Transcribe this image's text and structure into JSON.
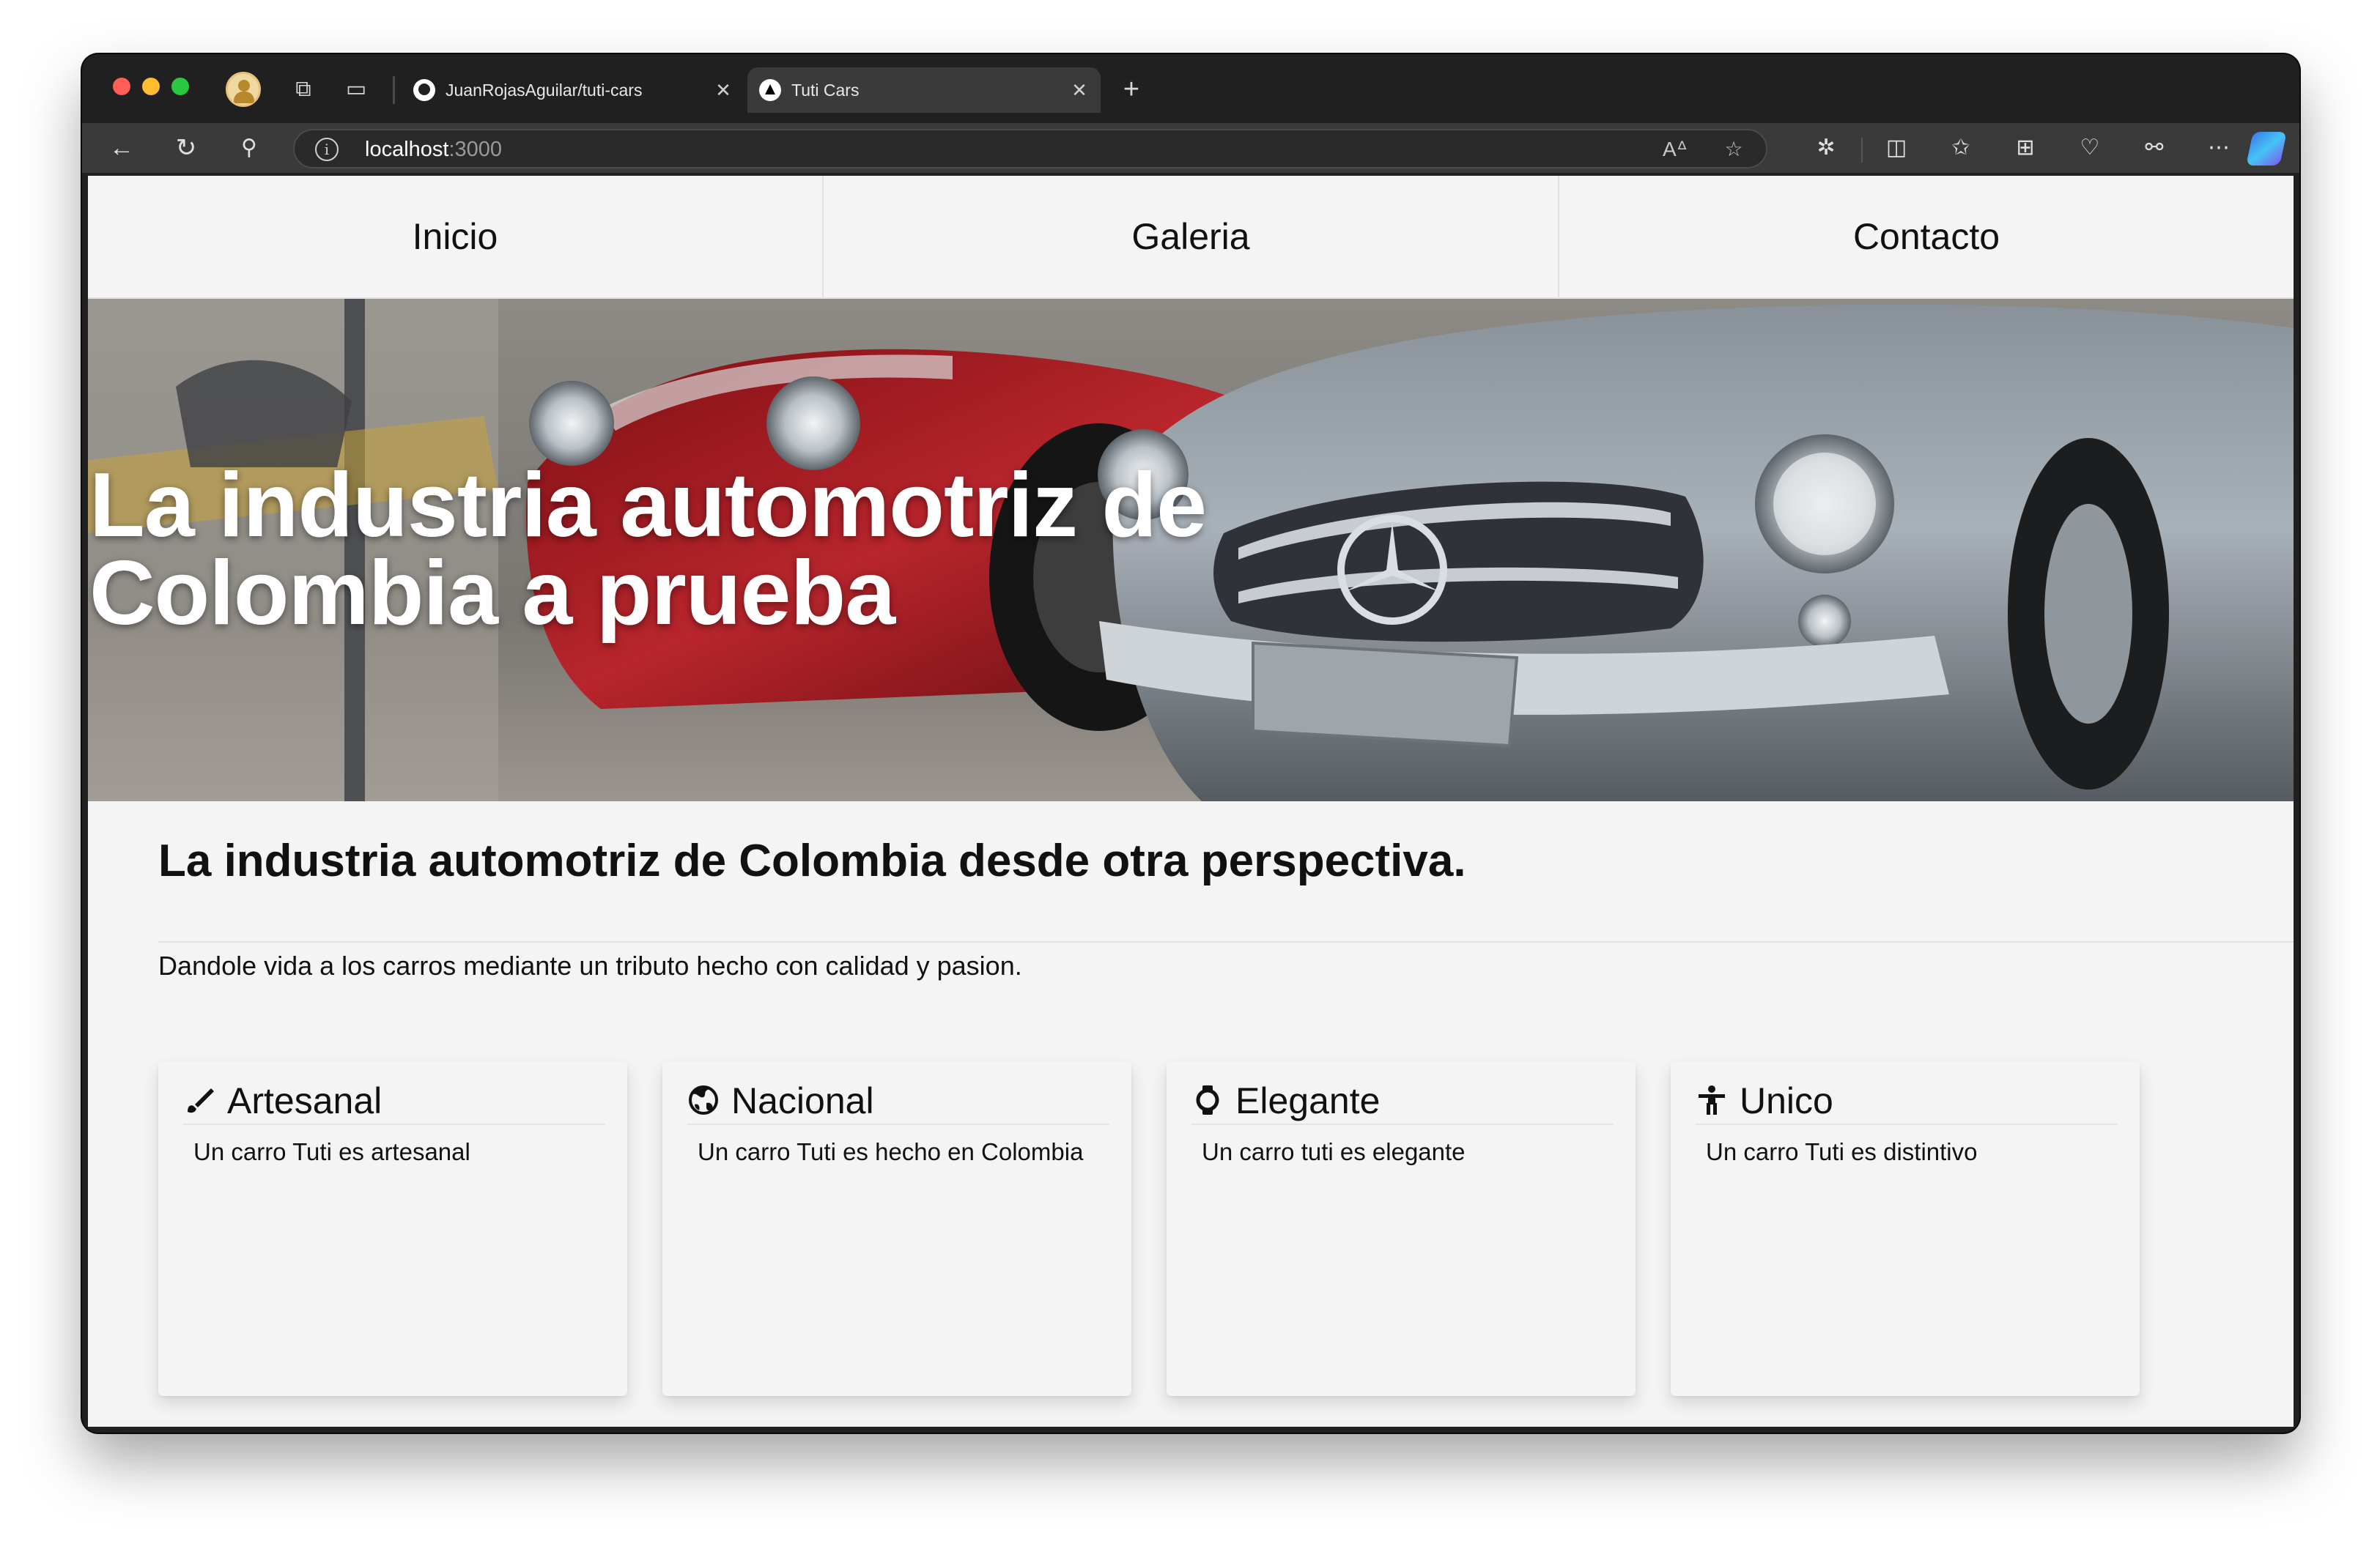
{
  "browser": {
    "tabs": [
      {
        "title": "JuanRojasAguilar/tuti-cars"
      },
      {
        "title": "Tuti Cars"
      }
    ],
    "url_host": "localhost",
    "url_port": ":3000"
  },
  "nav": {
    "items": [
      "Inicio",
      "Galeria",
      "Contacto"
    ]
  },
  "hero": {
    "title_line1": "La industria automotriz de",
    "title_line2": "Colombia a prueba"
  },
  "intro": {
    "title": "La industria automotriz de Colombia desde otra perspectiva.",
    "subtitle": "Dandole vida a los carros mediante un tributo hecho con calidad y pasion."
  },
  "cards": [
    {
      "icon": "brush-icon",
      "title": "Artesanal",
      "text": "Un carro Tuti es artesanal"
    },
    {
      "icon": "globe-icon",
      "title": "Nacional",
      "text": "Un carro Tuti es hecho en Colombia"
    },
    {
      "icon": "watch-icon",
      "title": "Elegante",
      "text": "Un carro tuti es elegante"
    },
    {
      "icon": "accessibility-icon",
      "title": "Unico",
      "text": "Un carro Tuti es distintivo"
    }
  ]
}
